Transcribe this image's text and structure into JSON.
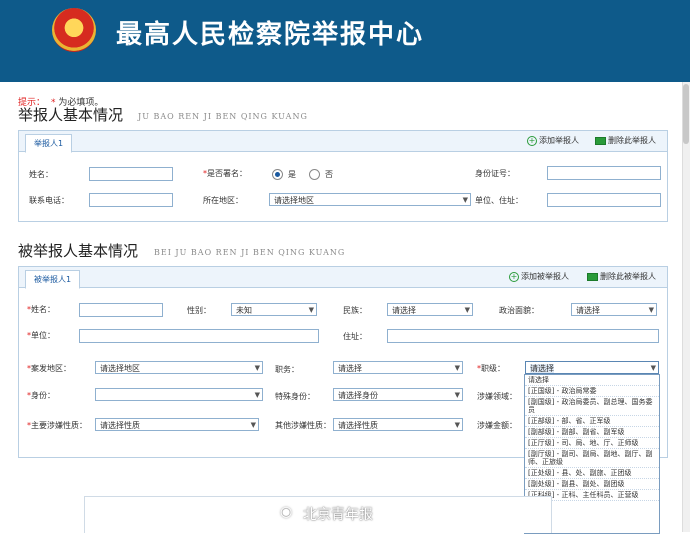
{
  "header": {
    "title": "最高人民检察院举报中心",
    "emblem": "national-emblem"
  },
  "hint": {
    "prefix": "提示：",
    "star": "*",
    "text": "为必填项。"
  },
  "reporter": {
    "title": "举报人基本情况",
    "subtitle": "JU BAO REN JI BEN QING KUANG",
    "tab": "举报人1",
    "add": "添加举报人",
    "remove": "删除此举报人",
    "name_label": "姓名：",
    "signed_label": "是否署名：",
    "yes": "是",
    "no": "否",
    "id_label": "身份证号：",
    "phone_label": "联系电话：",
    "region_label": "所在地区：",
    "region_value": "请选择地区",
    "address_label": "单位、住址："
  },
  "reported": {
    "title": "被举报人基本情况",
    "subtitle": "BEI JU BAO REN JI BEN QING KUANG",
    "tab": "被举报人1",
    "add": "添加被举报人",
    "remove": "删除此被举报人",
    "name_label": "姓名：",
    "gender_label": "性别：",
    "gender_value": "未知",
    "ethnic_label": "民族：",
    "ethnic_value": "请选择",
    "political_label": "政治面貌：",
    "political_value": "请选择",
    "unit_label": "单位：",
    "address_label": "住址：",
    "case_region_label": "案发地区：",
    "case_region_value": "请选择地区",
    "position_label": "职务：",
    "position_value": "请选择",
    "rank_label": "职级：",
    "rank_value": "请选择",
    "identity_label": "身份：",
    "special_identity_label": "特殊身份：",
    "special_identity_value": "请选择身份",
    "field_label": "涉嫌领域：",
    "main_nature_label": "主要涉嫌性质：",
    "main_nature_value": "请选择性质",
    "other_nature_label": "其他涉嫌性质：",
    "other_nature_value": "请选择性质",
    "amount_label": "涉嫌金额："
  },
  "rank_options": [
    "请选择",
    "[正国级] - 政治局常委",
    "[副国级] - 政治局委员、副总理、国务委员",
    "[正部级] - 部、省、正军级",
    "[副部级] - 副部、副省、副军级",
    "[正厅级] - 司、局、地、厅、正师级",
    "[副厅级] - 副司、副局、副地、副厅、副师、正旅级",
    "[正处级] - 县、处、副旅、正团级",
    "[副处级] - 副县、副处、副团级",
    "[正科级] - 正科、主任科员、正营级"
  ],
  "watermark": "北京青年报"
}
